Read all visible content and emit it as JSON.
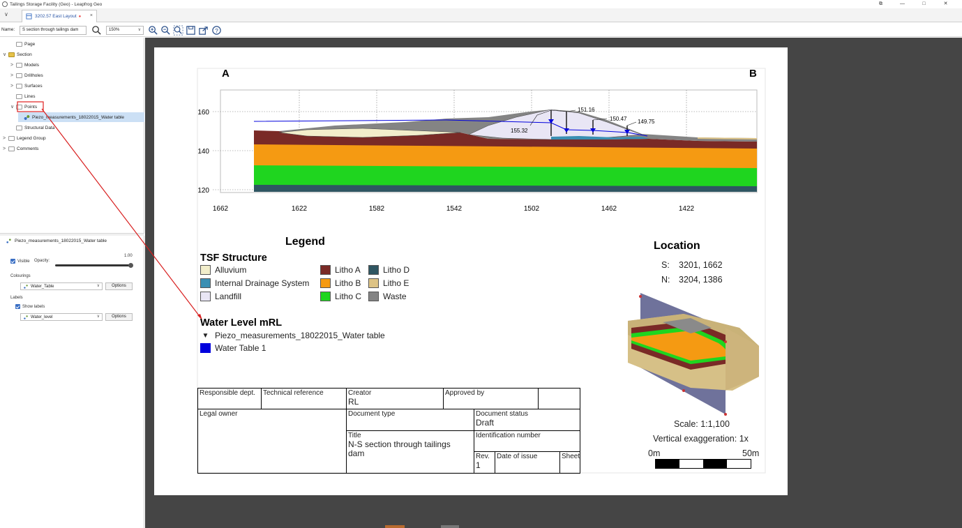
{
  "window": {
    "title": "Tailings Storage Facility (Geo) - Leapfrog Geo",
    "controls": [
      "⧉",
      "—",
      "□",
      "✕"
    ]
  },
  "tab": {
    "label": "3202.57 East Layout",
    "modified": "●",
    "close": "×"
  },
  "toolbar": {
    "name_label": "Name:",
    "name_value": "S section through tailings dam",
    "zoom_value": "150%"
  },
  "tree": {
    "items": [
      {
        "label": "Page",
        "indent": 1,
        "chev": ""
      },
      {
        "label": "Section",
        "indent": 0,
        "chev": "∨"
      },
      {
        "label": "Models",
        "indent": 1,
        "chev": ">"
      },
      {
        "label": "Drillholes",
        "indent": 1,
        "chev": ">"
      },
      {
        "label": "Surfaces",
        "indent": 1,
        "chev": ">"
      },
      {
        "label": "Lines",
        "indent": 1,
        "chev": ""
      },
      {
        "label": "Points",
        "indent": 1,
        "chev": "∨"
      },
      {
        "label": "Piezo_measurements_18022015_Water table",
        "indent": 2,
        "chev": ""
      },
      {
        "label": "Structural Data",
        "indent": 1,
        "chev": ""
      },
      {
        "label": "Legend Group",
        "indent": 0,
        "chev": ">"
      },
      {
        "label": "Comments",
        "indent": 0,
        "chev": ">"
      }
    ]
  },
  "properties": {
    "title": "Piezo_measurements_18022015_Water table",
    "visible_label": "Visible",
    "opacity_label": "Opacity:",
    "opacity_value": "1.00",
    "colourings_label": "Colourings",
    "colouring_value": "Water_Table",
    "options_label": "Options",
    "labels_label": "Labels",
    "show_labels_label": "Show labels",
    "label_value": "Water_level"
  },
  "section": {
    "left_label": "A",
    "right_label": "B",
    "y_ticks": [
      "160",
      "140",
      "120"
    ],
    "x_ticks": [
      "1662",
      "1622",
      "1582",
      "1542",
      "1502",
      "1462",
      "1422"
    ],
    "annotations": [
      "151.16",
      "150.47",
      "149.75",
      "155.32"
    ]
  },
  "legend": {
    "title": "Legend",
    "tsf_heading": "TSF Structure",
    "items": [
      {
        "label": "Alluvium",
        "color": "#f2eecb"
      },
      {
        "label": "Internal Drainage System",
        "color": "#3a8fb3"
      },
      {
        "label": "Landfill",
        "color": "#e9e6f5"
      },
      {
        "label": "Litho A",
        "color": "#7a2a26"
      },
      {
        "label": "Litho B",
        "color": "#f59a12"
      },
      {
        "label": "Litho C",
        "color": "#1fd51f"
      },
      {
        "label": "Litho D",
        "color": "#2f5662"
      },
      {
        "label": "Litho E",
        "color": "#ddc385"
      },
      {
        "label": "Waste",
        "color": "#848484"
      }
    ],
    "water_heading": "Water Level mRL",
    "water_symbol": "▼",
    "water_piezo_label": "Piezo_measurements_18022015_Water table",
    "water_table_label": "Water Table 1",
    "water_table_color": "#0000dd"
  },
  "location": {
    "title": "Location",
    "s_label": "S:",
    "s_value": "3201, 1662",
    "n_label": "N:",
    "n_value": "3204, 1386",
    "scale": "Scale: 1:1,100",
    "vexag": "Vertical exaggeration: 1x",
    "scale_start": "0m",
    "scale_end": "50m"
  },
  "titleblock": {
    "responsible": "Responsible dept.",
    "technical": "Technical reference",
    "creator_label": "Creator",
    "creator_value": "RL",
    "approved": "Approved by",
    "legal": "Legal owner",
    "doctype": "Document type",
    "docstatus_label": "Document status",
    "docstatus_value": "Draft",
    "title_label": "Title",
    "title_value": "N-S section through tailings dam",
    "idnum": "Identification number",
    "rev_label": "Rev.",
    "rev_value": "1",
    "date_issue": "Date of issue",
    "sheet": "Sheet"
  }
}
